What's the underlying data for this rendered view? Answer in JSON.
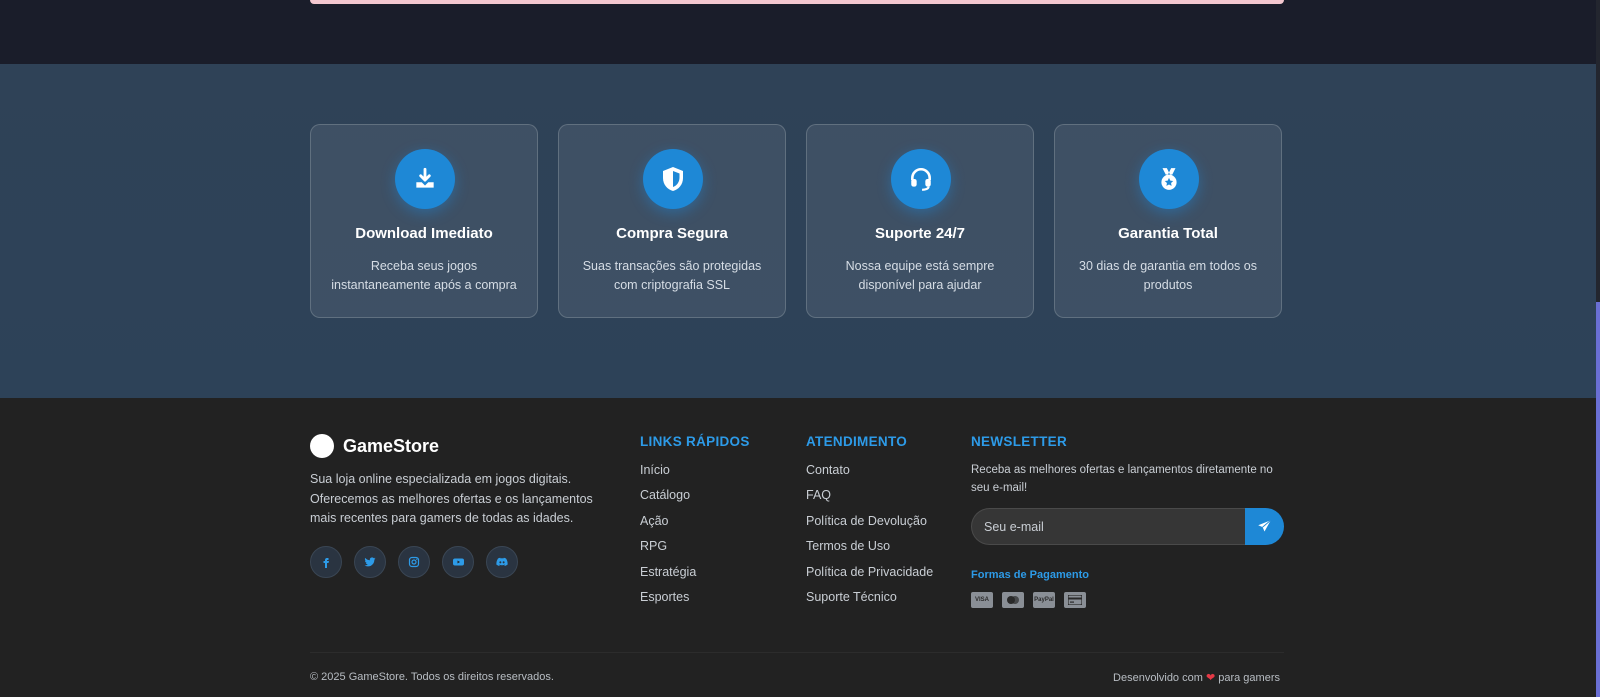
{
  "features": [
    {
      "title": "Download Imediato",
      "description": "Receba seus jogos instantaneamente após a compra",
      "icon": "download-icon"
    },
    {
      "title": "Compra Segura",
      "description": "Suas transações são protegidas com criptografia SSL",
      "icon": "shield-icon"
    },
    {
      "title": "Suporte 24/7",
      "description": "Nossa equipe está sempre disponível para ajudar",
      "icon": "headset-icon"
    },
    {
      "title": "Garantia Total",
      "description": "30 dias de garantia em todos os produtos",
      "icon": "medal-icon"
    }
  ],
  "brand": {
    "name": "GameStore",
    "description": "Sua loja online especializada em jogos digitais. Oferecemos as melhores ofertas e os lançamentos mais recentes para gamers de todas as idades."
  },
  "socials": [
    "facebook-icon",
    "twitter-icon",
    "instagram-icon",
    "youtube-icon",
    "discord-icon"
  ],
  "quick_links": {
    "title": "LINKS RÁPIDOS",
    "items": [
      "Início",
      "Catálogo",
      "Ação",
      "RPG",
      "Estratégia",
      "Esportes"
    ]
  },
  "support": {
    "title": "ATENDIMENTO",
    "items": [
      "Contato",
      "FAQ",
      "Política de Devolução",
      "Termos de Uso",
      "Política de Privacidade",
      "Suporte Técnico"
    ]
  },
  "newsletter": {
    "title": "NEWSLETTER",
    "description": "Receba as melhores ofertas e lançamentos diretamente no seu e-mail!",
    "placeholder": "Seu e-mail",
    "payment_title": "Formas de Pagamento",
    "payment_methods": [
      "VISA",
      "MC",
      "PayPal",
      "CARD"
    ]
  },
  "bottom": {
    "copyright": "© 2025 GameStore. Todos os direitos reservados.",
    "made_prefix": "Desenvolvido com",
    "made_suffix": "para gamers"
  },
  "colors": {
    "accent": "#1e88d6",
    "footer_bg": "#222222",
    "features_bg": "#2f4257",
    "heart": "#e53946"
  }
}
